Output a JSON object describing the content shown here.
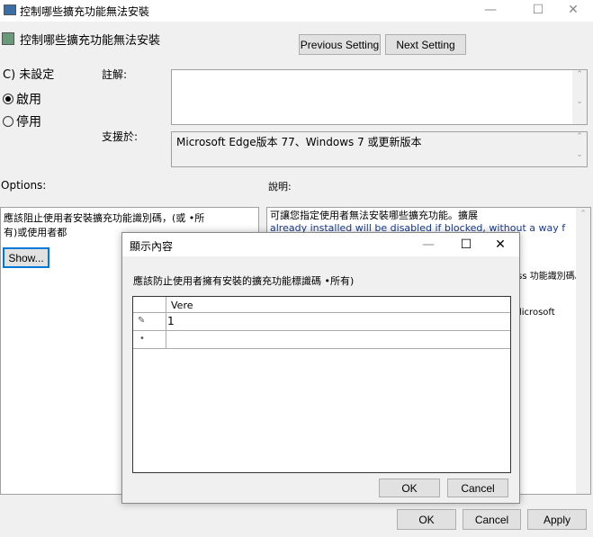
{
  "window": {
    "title": "控制哪些擴充功能無法安裝"
  },
  "header": {
    "title": "控制哪些擴充功能無法安裝",
    "previous_label": "Previous Setting",
    "next_label": "Next Setting"
  },
  "state": {
    "not_configured": "未設定",
    "enabled": "啟用",
    "disabled": "停用",
    "selected": "enabled"
  },
  "comment": {
    "label": "註解:",
    "value": ""
  },
  "supported": {
    "label": "支援於:",
    "value": "Microsoft Edge版本 77、Windows 7 或更新版本"
  },
  "options": {
    "label": "Options:",
    "text": "應該阻止使用者安裝擴充功能識別碼，(或 •所有)或使用者都",
    "show_label": "Show..."
  },
  "help": {
    "label": "說明:",
    "line1": "可讓您指定使用者無法安裝哪些擴充功能。擴展",
    "line2": "already installed will be disabled if blocked, without a way f無法安裝擴充",
    "line3": "ess 功能識別碼。",
    "line4": "licrosoft"
  },
  "dialog": {
    "title": "顯示內容",
    "label": "應該防止使用者擁有安裝的擴充功能標識碼 •所有)",
    "column": "Vere",
    "rows": [
      {
        "marker": "pencil",
        "value": "1"
      },
      {
        "marker": "new-row",
        "value": ""
      }
    ],
    "ok_label": "OK",
    "cancel_label": "Cancel"
  },
  "footer": {
    "ok_label": "OK",
    "cancel_label": "Cancel",
    "apply_label": "Apply"
  }
}
